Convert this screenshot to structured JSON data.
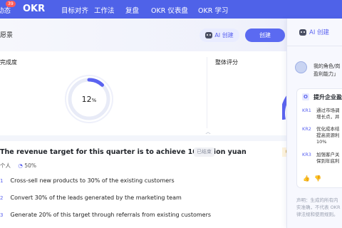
{
  "topnav": {
    "badge_count": "39",
    "items": [
      "动态",
      "OKR",
      "目标对齐",
      "工作法",
      "复盘",
      "OKR 仪表盘",
      "OKR 学习"
    ]
  },
  "header": {
    "title": "愿景",
    "ai_create_label": "AI 创建",
    "create_label": "创建"
  },
  "stats": {
    "progress_label": "完成度",
    "progress_value": "12",
    "progress_unit": "%",
    "progress_fraction": 0.12,
    "score_label": "整体评分"
  },
  "objective": {
    "title": "The revenue target for this quarter is to achieve 10 million yuan",
    "status": "已结束",
    "right_tag": "0.",
    "meta_people": "个人",
    "meta_progress": "50%",
    "key_results": [
      {
        "num": "1",
        "text": "Cross-sell new products to 30% of the existing customers"
      },
      {
        "num": "2",
        "text": "Convert 30% of the leads generated by the marketing team"
      },
      {
        "num": "3",
        "text": "Generate 20% of this target through referrals from existing customers"
      }
    ]
  },
  "ai_panel": {
    "title": "AI 创建",
    "user_message_line1": "我的角色/岗",
    "user_message_line2": "盈利能力」",
    "card_title": "提升企业盈",
    "card_o_letter": "O",
    "krs": [
      {
        "label": "KR1",
        "line1": "通过市场调",
        "line2": "增长点，并"
      },
      {
        "label": "KR2",
        "line1": "优化成本结",
        "line2": "提高资源利",
        "line3": "10%"
      },
      {
        "label": "KR3",
        "line1": "加强客户关",
        "line2": "保到年底利"
      }
    ],
    "disclaimer_line1": "声明：生成的所有内",
    "disclaimer_line2": "实准确，不代表 OKR",
    "disclaimer_line3": "律法规和使用规则。"
  },
  "colors": {
    "nav_bg": "#4f62e8",
    "accent": "#5b63f0",
    "ring_track": "#e8ebf7"
  }
}
